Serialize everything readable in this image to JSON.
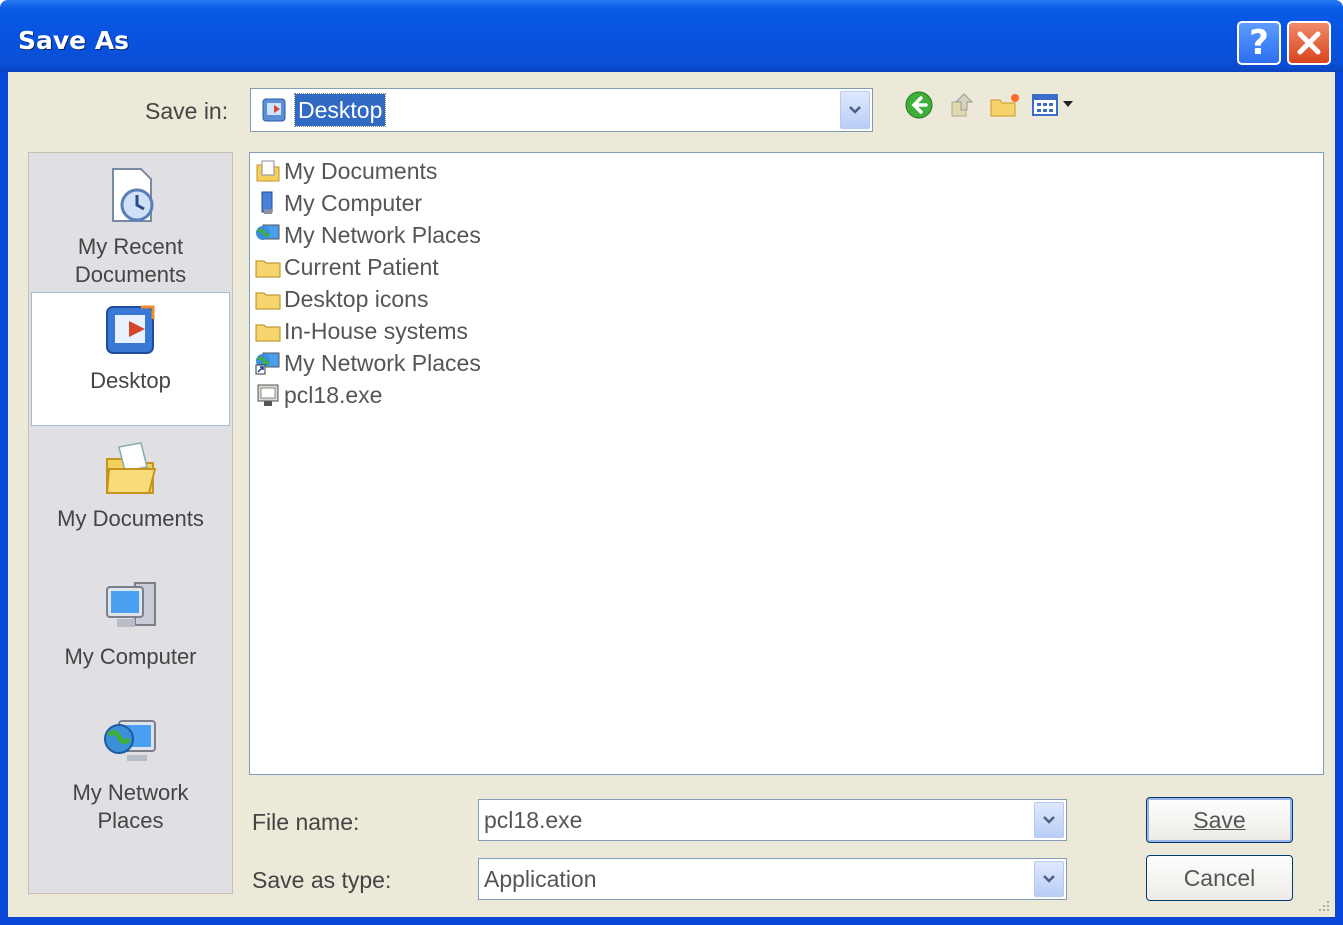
{
  "window": {
    "title": "Save As"
  },
  "titlebar": {
    "help_icon": "question-mark-icon",
    "close_icon": "close-x-icon"
  },
  "savein": {
    "label": "Save in:",
    "value": "Desktop",
    "value_icon": "desktop-icon"
  },
  "toolbar": {
    "back_icon": "back-arrow-icon",
    "up_icon": "up-one-level-icon",
    "new_folder_icon": "new-folder-icon",
    "views_icon": "view-menu-icon"
  },
  "places": [
    {
      "label": "My Recent\nDocuments",
      "icon": "recent-documents-icon"
    },
    {
      "label": "Desktop",
      "icon": "desktop-icon",
      "active": true
    },
    {
      "label": "My Documents",
      "icon": "my-documents-icon"
    },
    {
      "label": "My Computer",
      "icon": "my-computer-icon"
    },
    {
      "label": "My Network\nPlaces",
      "icon": "network-places-icon"
    }
  ],
  "files": [
    {
      "name": "My Documents",
      "icon": "my-documents-small-icon"
    },
    {
      "name": "My Computer",
      "icon": "computer-small-icon"
    },
    {
      "name": "My Network Places",
      "icon": "network-small-icon"
    },
    {
      "name": "Current Patient",
      "icon": "folder-icon"
    },
    {
      "name": "Desktop icons",
      "icon": "folder-icon"
    },
    {
      "name": "In-House systems",
      "icon": "folder-icon"
    },
    {
      "name": "My Network Places",
      "icon": "network-shortcut-icon"
    },
    {
      "name": "pcl18.exe",
      "icon": "exe-file-icon"
    }
  ],
  "filename": {
    "label": "File name:",
    "value": "pcl18.exe"
  },
  "filetype": {
    "label": "Save as type:",
    "value": "Application"
  },
  "buttons": {
    "save": "Save",
    "cancel": "Cancel"
  },
  "colors": {
    "titlebar": "#0753e0",
    "selection": "#316ac5",
    "dialog_bg": "#ece9d8"
  }
}
